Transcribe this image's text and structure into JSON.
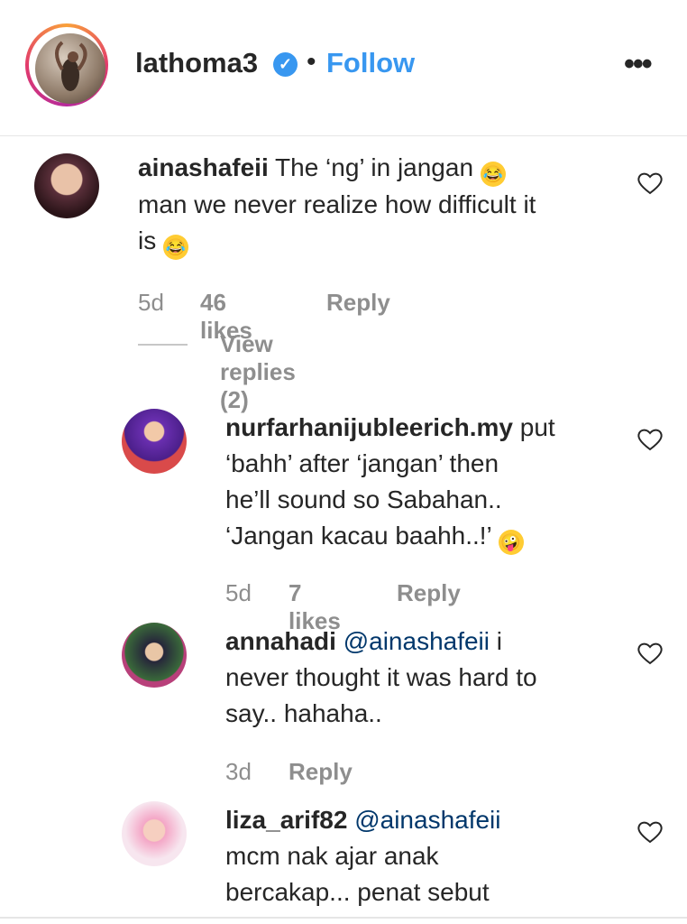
{
  "post": {
    "username": "lathoma3",
    "verified": true,
    "separator": "•",
    "follow_label": "Follow",
    "more_label": "•••"
  },
  "comments": [
    {
      "username": "ainashafeii",
      "text_1": "The ‘ng’ in jangan",
      "text_2": "man we never realize how difficult it",
      "text_3": "is",
      "age": "5d",
      "likes": "46 likes",
      "reply_label": "Reply",
      "view_replies": "View replies (2)"
    },
    {
      "username": "nurfarhanijubleerich.my",
      "text_1": "put",
      "text_2": "‘bahh’ after ‘jangan’ then",
      "text_3": "he’ll sound so Sabahan..",
      "text_4": "‘Jangan kacau baahh..!’",
      "age": "5d",
      "likes": "7 likes",
      "reply_label": "Reply"
    },
    {
      "username": "annahadi",
      "mention": "@ainashafeii",
      "text_1": "i",
      "text_2": "never thought it was hard to",
      "text_3": "say.. hahaha..",
      "age": "3d",
      "reply_label": "Reply"
    },
    {
      "username": "liza_arif82",
      "mention": "@ainashafeii",
      "text_2": "mcm nak ajar anak",
      "text_3": "bercakap... penat sebut"
    }
  ],
  "icons": {
    "heart": "heart-icon",
    "verified": "verified-badge-icon",
    "emoji_laugh": "tears-of-joy-emoji",
    "emoji_zany": "zany-face-emoji"
  },
  "colors": {
    "link_blue": "#3897f0",
    "mention_blue": "#00376b",
    "muted_gray": "#8e8e8e",
    "text": "#262626"
  }
}
